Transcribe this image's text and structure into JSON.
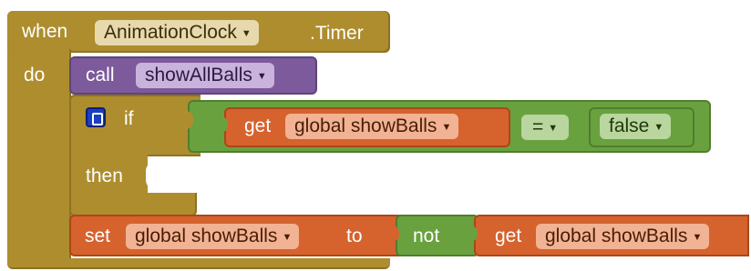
{
  "event_block": {
    "when_label": "when",
    "component": "AnimationClock",
    "event": ".Timer",
    "do_label": "do",
    "color": "#ad8d2e"
  },
  "call_block": {
    "call_label": "call",
    "procedure": "showAllBalls",
    "color": "#7c5a9b"
  },
  "if_block": {
    "if_label": "if",
    "then_label": "then",
    "mutator_icon": "gear-mutator-icon",
    "color": "#ad8d2e"
  },
  "compare_block": {
    "operator": "=",
    "color": "#6aa13f"
  },
  "get_condition": {
    "get_label": "get",
    "variable": "global showBalls",
    "color": "#d6622e"
  },
  "false_block": {
    "value": "false",
    "color": "#6aa13f"
  },
  "set_block": {
    "set_label": "set",
    "variable": "global showBalls",
    "to_label": "to",
    "color": "#d6622e"
  },
  "not_block": {
    "label": "not",
    "color": "#6aa13f"
  },
  "get_value": {
    "get_label": "get",
    "variable": "global showBalls",
    "color": "#d6622e"
  }
}
